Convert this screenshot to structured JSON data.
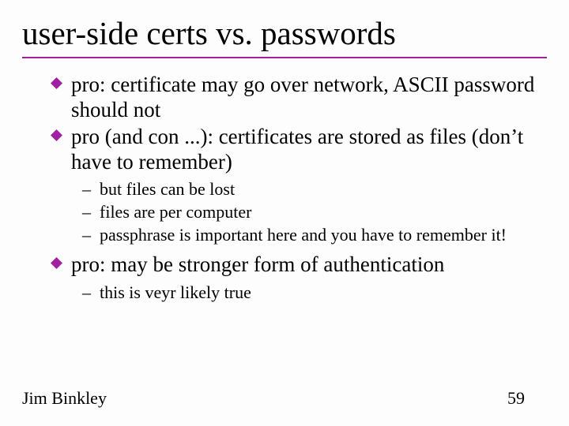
{
  "title": "user-side certs vs. passwords",
  "bullets": {
    "b1": "pro: certificate may go over network, ASCII password should not",
    "b2": "pro (and con ...): certificates are stored as files (don’t have to remember)",
    "b2_subs": {
      "s1": "but files can be lost",
      "s2": "files are per computer",
      "s3": "passphrase is important here and you have to remember it!"
    },
    "b3": "pro: may be stronger form of authentication",
    "b3_subs": {
      "s1": "this is veyr likely true"
    }
  },
  "dash": "–",
  "footer": {
    "author": "Jim Binkley",
    "page": "59"
  },
  "colors": {
    "accent": "#a020a0"
  }
}
